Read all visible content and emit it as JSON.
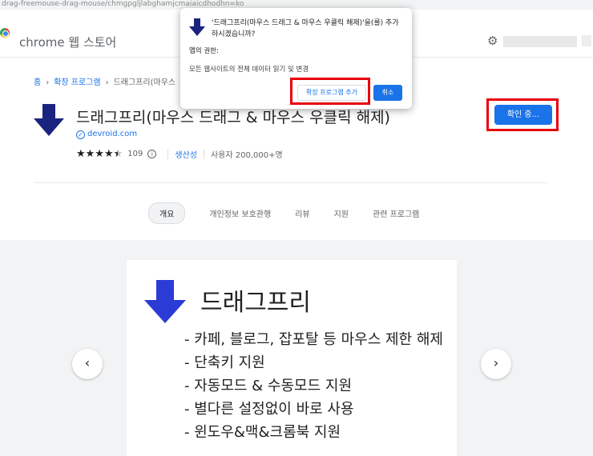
{
  "browser": {
    "url_fragment": "drag-freemouse-drag-mouse/chmgpgljlabghamjcmaiaicdhodhn=ko"
  },
  "store": {
    "title": "chrome 웹 스토어"
  },
  "breadcrumb": {
    "home": "홈",
    "category": "확장 프로그램",
    "current": "드래그프리(마우스",
    "separator": "›"
  },
  "extension": {
    "title": "드래그프리(마우스 드래그 & 마우스 우클릭 해제)",
    "developer": "devroid.com",
    "rating_count": "109",
    "category": "생산성",
    "users": "사용자 200,000+명",
    "install_button": "확인 중..."
  },
  "tabs": {
    "items": [
      {
        "label": "개요",
        "active": true
      },
      {
        "label": "개인정보 보호관행",
        "active": false
      },
      {
        "label": "리뷰",
        "active": false
      },
      {
        "label": "지원",
        "active": false
      },
      {
        "label": "관련 프로그램",
        "active": false
      }
    ]
  },
  "gallery": {
    "slide_title": "드래그프리",
    "bullets": [
      "- 카페, 블로그, 잡포탈 등 마우스 제한 해제",
      "- 단축키 지원",
      "- 자동모드 & 수동모드 지원",
      "- 별다른 설정없이 바로 사용",
      "- 윈도우&맥&크롬북 지원"
    ],
    "prev_icon": "‹",
    "next_icon": "›"
  },
  "dialog": {
    "title": "'드래그프리(마우스 드래그 & 마우스 우클릭 해제)'을(를) 추가하시겠습니까?",
    "permissions_heading": "앱의 권한:",
    "permission": "모든 웹사이트의 전체 데이터 읽기 및 변경",
    "add_button": "확장 프로그램 추가",
    "cancel_button": "취소"
  },
  "colors": {
    "accent": "#1a73e8",
    "highlight": "#e8000b",
    "arrow_dark": "#1a237e",
    "arrow_slide": "#2b3bd6"
  }
}
